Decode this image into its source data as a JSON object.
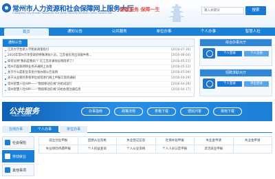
{
  "header": {
    "title": "常州市人力资源和社会保障网上服务大厅",
    "subtitle": "Changzhou City Human Resources and Social Security Services Online Service Hall",
    "slogan": "智慧服务   保障一生",
    "search_placeholder": "输入关键词",
    "search_label": "搜索"
  },
  "nav": {
    "items": [
      "首页",
      "通知公告",
      "公共服务",
      "单位办事",
      "个人办事",
      "智慧人社"
    ],
    "active_index": 0
  },
  "notice": {
    "tab_label": "通知公告",
    "items": [
      {
        "title": "江苏大学生新入学相关政策指引",
        "date": "[2016-07-30]"
      },
      {
        "title": "2016年常州市享受政府特殊津贴人员、江苏省有突出贡献中青...",
        "date": "[2016-06-04]"
      },
      {
        "title": "如何证明\"我妈是我妈\"？在江苏开通你证明简单了！",
        "date": "[2016-05-21]"
      },
      {
        "title": "常州市医保转移业务开通网上办理",
        "date": "[2016-05-12]"
      },
      {
        "title": "关于什么是职业年金计划办理公告说明",
        "date": "[2016-05-09]"
      },
      {
        "title": "关于从业保险参保单位如何进行网上申报工资的通知",
        "date": "[2016-04-29]"
      },
      {
        "title": "常州智慧人社APP——\"我保移动在线\"开始试运行",
        "date": "[2016-04-26]"
      },
      {
        "title": "常州智慧人社APP——\"我保移动在线\"开始办理注册信息",
        "date": "[2016-04-17]"
      }
    ]
  },
  "personal_hall": {
    "title": "综合办事大厅",
    "login_label": "个人登录",
    "register_label": "个人注册"
  },
  "unit_hall": {
    "title": "招聘求职大厅",
    "login_label": "个人登录",
    "register_label": "单位登录"
  },
  "banner": {
    "title": "公共服务",
    "subtitle": "PUBLIC SERVICE",
    "links": [
      "办事指南",
      "政策法规",
      "表格下载",
      "便民问答",
      "常用下载"
    ]
  },
  "tabs": {
    "items": [
      "在线办事",
      "个人办事",
      "单位办事"
    ],
    "active_index": 1
  },
  "sidebar": {
    "items": [
      {
        "label": "社会保险",
        "icon": "shield-icon"
      },
      {
        "label": "劳动就业",
        "icon": "briefcase-icon"
      },
      {
        "label": "其他事项",
        "icon": "grid-icon"
      }
    ],
    "active_index": 1
  },
  "services": [
    "就业创业申报",
    "团建从业资格",
    "失业登记信息",
    "社保补贴申报",
    "失业金申请",
    "失业金申请",
    "失业保险待遇申报",
    "个人权益查询",
    "个人从业资格",
    "个人人员认定申报",
    "灵活就业申报",
    ""
  ],
  "colors": {
    "brand": "#1c7fd6",
    "brand_dark": "#0f5fb3",
    "header_bg": "#e9f2fb",
    "slogan": "#e0534d"
  }
}
